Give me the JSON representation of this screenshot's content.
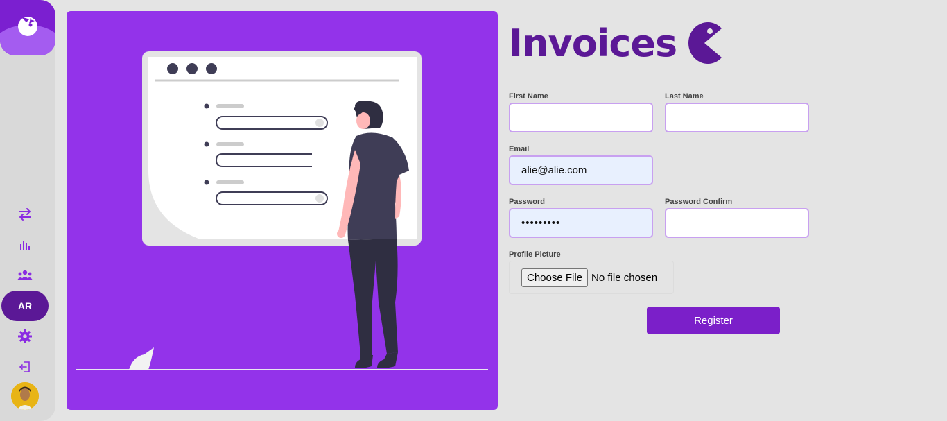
{
  "brand": {
    "title": "Invoices"
  },
  "sidebar": {
    "items": [
      {
        "name": "transfer",
        "icon": "arrows-exchange-icon"
      },
      {
        "name": "stats",
        "icon": "bar-chart-icon"
      },
      {
        "name": "users",
        "icon": "users-icon"
      },
      {
        "name": "initials",
        "label": "AR"
      },
      {
        "name": "settings",
        "icon": "gear-icon"
      },
      {
        "name": "logout",
        "icon": "logout-icon"
      }
    ]
  },
  "form": {
    "first_name_label": "First Name",
    "first_name_value": "",
    "last_name_label": "Last Name",
    "last_name_value": "",
    "email_label": "Email",
    "email_value": "alie@alie.com",
    "password_label": "Password",
    "password_value": "•••••••••",
    "password_confirm_label": "Password Confirm",
    "password_confirm_value": "",
    "profile_picture_label": "Profile Picture",
    "file_button_label": "Choose File",
    "file_status": "No file chosen",
    "register_label": "Register"
  },
  "colors": {
    "accent": "#9333ea",
    "brand_dark": "#5b1896",
    "input_border": "#c8a0f0"
  }
}
